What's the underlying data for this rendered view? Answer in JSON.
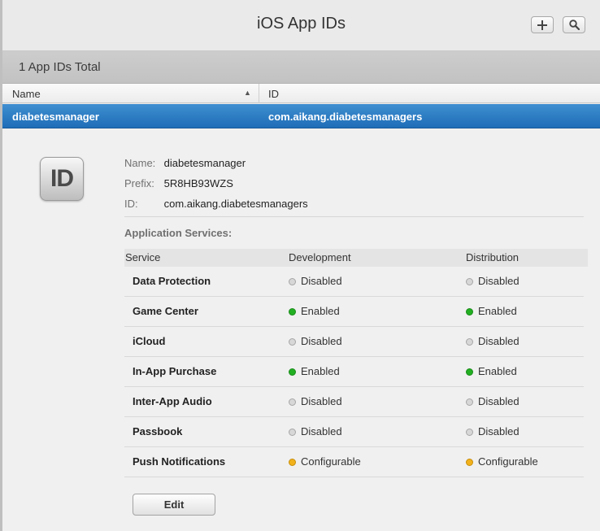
{
  "header": {
    "title": "iOS App IDs",
    "add_label": "+",
    "icons": [
      "plus-icon",
      "search-icon"
    ]
  },
  "count_bar": {
    "label": "1 App IDs Total"
  },
  "table": {
    "columns": [
      "Name",
      "ID"
    ],
    "rows": [
      {
        "name": "diabetesmanager",
        "id": "com.aikang.diabetesmanagers",
        "selected": true
      }
    ]
  },
  "details": {
    "icon_text": "ID",
    "name_label": "Name:",
    "name_value": "diabetesmanager",
    "prefix_label": "Prefix:",
    "prefix_value": "5R8HB93WZS",
    "id_label": "ID:",
    "id_value": "com.aikang.diabetesmanagers",
    "services_heading": "Application Services:",
    "services_columns": [
      "Service",
      "Development",
      "Distribution"
    ],
    "services": [
      {
        "name": "Data Protection",
        "development": "Disabled",
        "distribution": "Disabled"
      },
      {
        "name": "Game Center",
        "development": "Enabled",
        "distribution": "Enabled"
      },
      {
        "name": "iCloud",
        "development": "Disabled",
        "distribution": "Disabled"
      },
      {
        "name": "In-App Purchase",
        "development": "Enabled",
        "distribution": "Enabled"
      },
      {
        "name": "Inter-App Audio",
        "development": "Disabled",
        "distribution": "Disabled"
      },
      {
        "name": "Passbook",
        "development": "Disabled",
        "distribution": "Disabled"
      },
      {
        "name": "Push Notifications",
        "development": "Configurable",
        "distribution": "Configurable"
      }
    ],
    "edit_label": "Edit"
  },
  "colors": {
    "selection": "#1e6db7",
    "enabled": "#22b022",
    "disabled": "#d7d7d7",
    "configurable": "#f2b21c"
  }
}
